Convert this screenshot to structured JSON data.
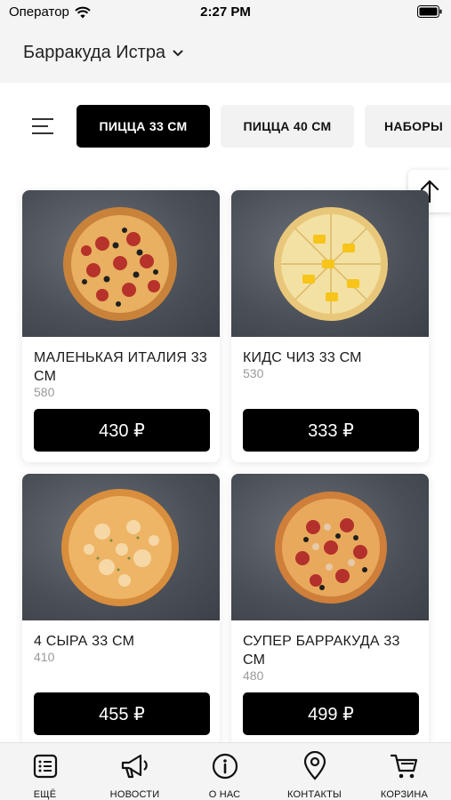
{
  "status_bar": {
    "carrier": "Оператор",
    "time": "2:27 PM"
  },
  "header": {
    "store_name": "Барракуда Истра"
  },
  "tabs": [
    {
      "label": "ПИЦЦА 33 СМ",
      "active": true
    },
    {
      "label": "ПИЦЦА 40 СМ",
      "active": false
    },
    {
      "label": "НАБОРЫ",
      "active": false
    }
  ],
  "products": [
    {
      "name": "МАЛЕНЬКАЯ ИТАЛИЯ 33 СМ",
      "weight": "580",
      "price": "430 ₽",
      "image": "pepperoni-olive-pizza"
    },
    {
      "name": "КИДС ЧИЗ 33 СМ",
      "weight": "530",
      "price": "333 ₽",
      "image": "cheese-pineapple-pizza"
    },
    {
      "name": "4 СЫРА 33 СМ",
      "weight": "410",
      "price": "455 ₽",
      "image": "four-cheese-pizza"
    },
    {
      "name": "СУПЕР БАРРАКУДА 33 СМ",
      "weight": "480",
      "price": "499 ₽",
      "image": "supreme-pizza"
    }
  ],
  "bottom_nav": [
    {
      "label": "ЕЩЁ",
      "icon": "list-icon"
    },
    {
      "label": "НОВОСТИ",
      "icon": "megaphone-icon"
    },
    {
      "label": "О НАС",
      "icon": "info-icon"
    },
    {
      "label": "КОНТАКТЫ",
      "icon": "location-pin-icon"
    },
    {
      "label": "КОРЗИНА",
      "icon": "cart-icon"
    }
  ],
  "colors": {
    "accent": "#000000",
    "background": "#f4f4f4",
    "card": "#ffffff"
  }
}
